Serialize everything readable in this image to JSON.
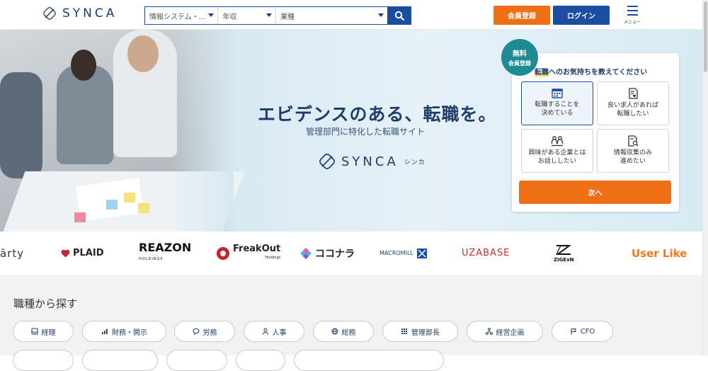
{
  "header": {
    "logo_text": "SYNCA",
    "search": {
      "job_select": "情報システム・…",
      "income_select": "年収",
      "industry_select": "業種"
    },
    "register_label": "会員登録",
    "login_label": "ログイン",
    "menu_label": "メニュー"
  },
  "hero": {
    "title": "エビデンスのある、転職を。",
    "subtitle": "管理部門に特化した転職サイト",
    "logo_text": "SYNCA",
    "logo_kana": "シンカ"
  },
  "card": {
    "badge_line1": "無料",
    "badge_line2": "会員登録",
    "title_highlight": "転職",
    "title_rest": "へのお気持ちを教えてください",
    "options": [
      {
        "line1": "転職することを",
        "line2": "決めている",
        "icon": "calendar-icon"
      },
      {
        "line1": "良い求人があれば",
        "line2": "転職したい",
        "icon": "document-heart-icon"
      },
      {
        "line1": "興味がある企業とは",
        "line2": "お話ししたい",
        "icon": "people-icon"
      },
      {
        "line1": "情報収集のみ",
        "line2": "進めたい",
        "icon": "document-search-icon"
      }
    ],
    "next_label": "次へ"
  },
  "logos": {
    "items": [
      "ārty",
      "PLAID",
      "REAZON",
      "HOLDINGS",
      "FreakOut",
      "Holdings",
      "ココナラ",
      "MACROMILL",
      "UZABASE",
      "ZIGExN",
      "User Like"
    ]
  },
  "section": {
    "title": "職種から探す",
    "chips": [
      "経理",
      "財務・開示",
      "労務",
      "人事",
      "総務",
      "管理部長",
      "経営企画",
      "CFO"
    ]
  },
  "colors": {
    "brand_navy": "#1b4da0",
    "accent_orange": "#ee6f16",
    "badge_teal": "#1f8a94"
  }
}
